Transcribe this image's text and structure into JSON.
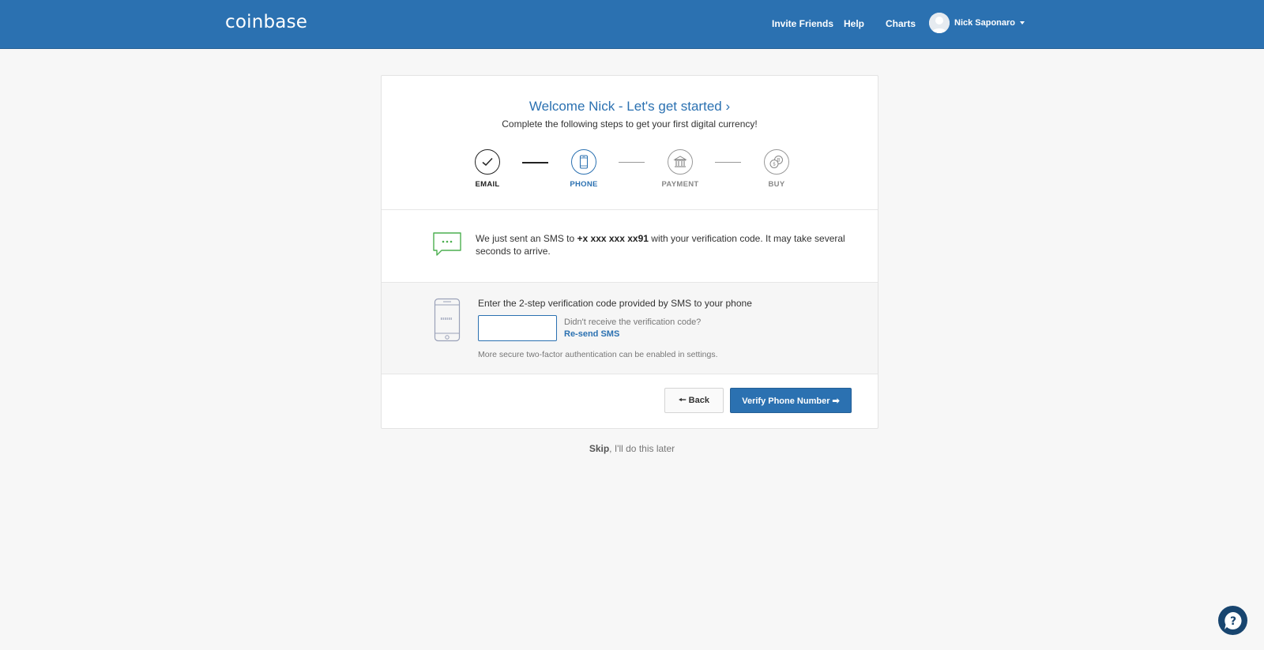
{
  "header": {
    "logo": "coinbase",
    "nav": {
      "invite": "Invite Friends",
      "help": "Help",
      "charts": "Charts"
    },
    "user": {
      "name": "Nick Saponaro"
    }
  },
  "card": {
    "welcome": "Welcome Nick - Let's get started ›",
    "subtitle": "Complete the following steps to get your first digital currency!",
    "steps": [
      {
        "label": "EMAIL",
        "state": "done",
        "icon": "checkmark-icon"
      },
      {
        "label": "PHONE",
        "state": "active",
        "icon": "smartphone-icon"
      },
      {
        "label": "PAYMENT",
        "state": "pending",
        "icon": "bank-icon"
      },
      {
        "label": "BUY",
        "state": "pending",
        "icon": "coins-icon"
      }
    ],
    "sms": {
      "prefix": "We just sent an SMS to ",
      "number": "+x xxx xxx xx91",
      "suffix": " with your verification code. It may take several seconds to arrive."
    },
    "verify": {
      "title": "Enter the 2-step verification code provided by SMS to your phone",
      "input_value": "",
      "didnt_receive": "Didn't receive the verification code?",
      "resend": "Re-send SMS",
      "secure_note": "More secure two-factor authentication can be enabled in settings."
    },
    "buttons": {
      "back": "🠔 Back",
      "verify": "Verify Phone Number ➡"
    }
  },
  "skip": {
    "skip": "Skip",
    "rest": ", I'll do this later"
  },
  "colors": {
    "brand": "#2b71b1",
    "success": "#4caf50"
  }
}
